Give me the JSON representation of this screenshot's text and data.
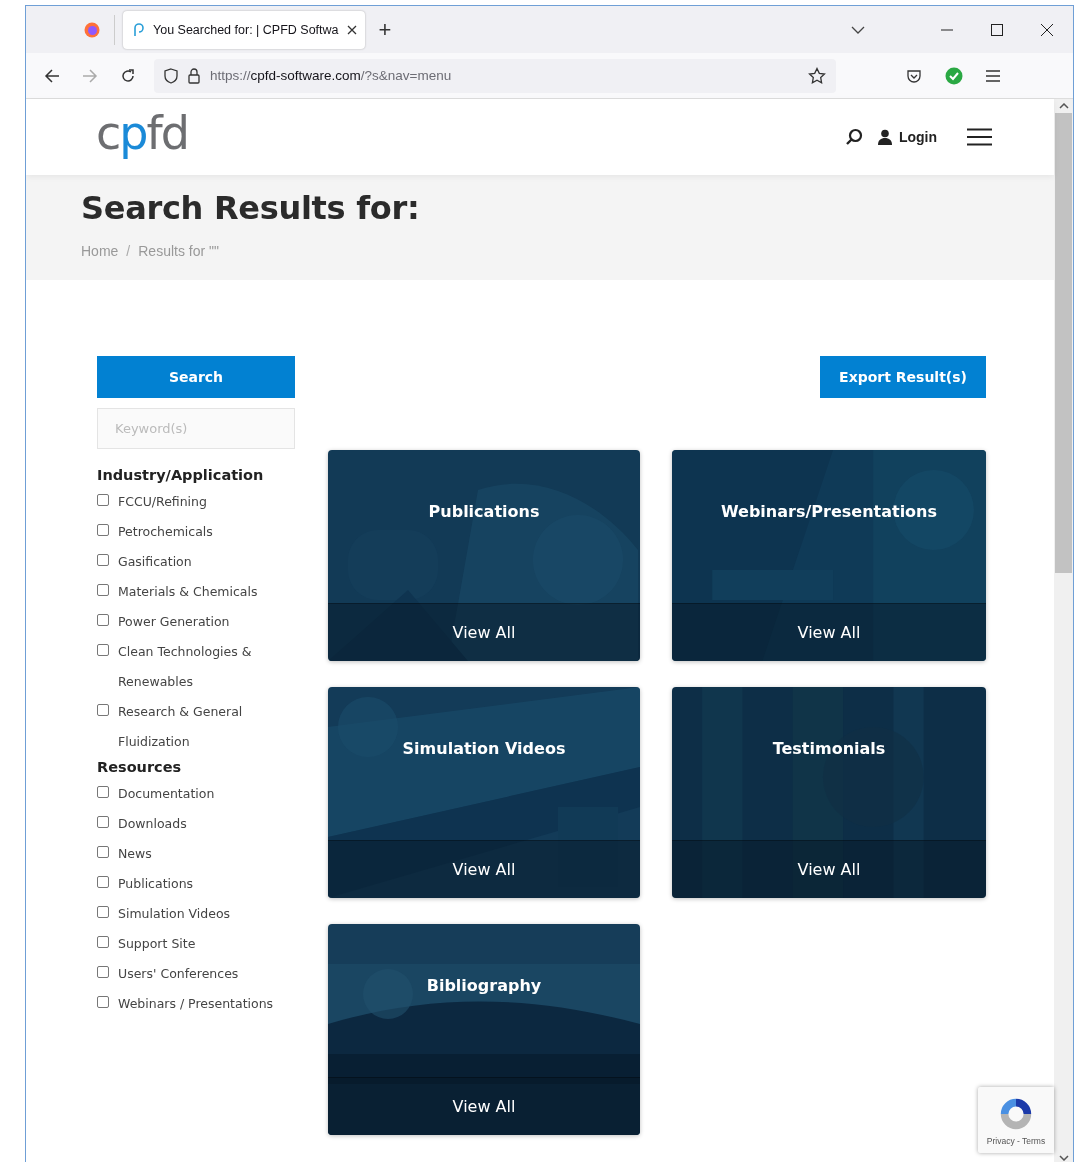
{
  "browser": {
    "tab_title": "You Searched for: | CPFD Softwa",
    "new_tab": "+",
    "url_scheme": "https://",
    "url_domain": "cpfd-software.com",
    "url_path": "/?s&nav=menu"
  },
  "header": {
    "logo": "cpfd",
    "login": "Login"
  },
  "banner": {
    "title": "Search Results for:",
    "breadcrumb_separator": "/",
    "breadcrumbs": [
      {
        "label": "Home"
      },
      {
        "label": "Results for \"\""
      }
    ]
  },
  "sidebar": {
    "search_button": "Search",
    "keyword_field": {
      "placeholder": "Keyword(s)"
    },
    "groups": [
      {
        "title": "Industry/Application",
        "options": [
          {
            "label": "FCCU/Refining",
            "checked": false
          },
          {
            "label": "Petrochemicals",
            "checked": false
          },
          {
            "label": "Gasification",
            "checked": false
          },
          {
            "label": "Materials & Chemicals",
            "checked": false
          },
          {
            "label": "Power Generation",
            "checked": false
          },
          {
            "label": "Clean Technologies & Renewables",
            "checked": false
          },
          {
            "label": "Research & General Fluidization",
            "checked": false
          }
        ]
      },
      {
        "title": "Resources",
        "options": [
          {
            "label": "Documentation",
            "checked": false
          },
          {
            "label": "Downloads",
            "checked": false
          },
          {
            "label": "News",
            "checked": false
          },
          {
            "label": "Publications",
            "checked": false
          },
          {
            "label": "Simulation Videos",
            "checked": false
          },
          {
            "label": "Support Site",
            "checked": false
          },
          {
            "label": "Users' Conferences",
            "checked": false
          },
          {
            "label": "Webinars / Presentations",
            "checked": false
          }
        ]
      }
    ]
  },
  "export_button": "Export Result(s)",
  "cards": [
    {
      "title": "Publications",
      "link": "View All",
      "kind": "picture"
    },
    {
      "title": "Webinars/Presentations",
      "link": "View All",
      "kind": "picture"
    },
    {
      "title": "Simulation Videos",
      "link": "View All",
      "kind": "picture"
    },
    {
      "title": "Testimonials",
      "link": "View All",
      "kind": "picture"
    },
    {
      "title": "Bibliography",
      "link": "View All",
      "kind": "picture"
    }
  ],
  "recaptcha": {
    "links": "Privacy - Terms"
  }
}
